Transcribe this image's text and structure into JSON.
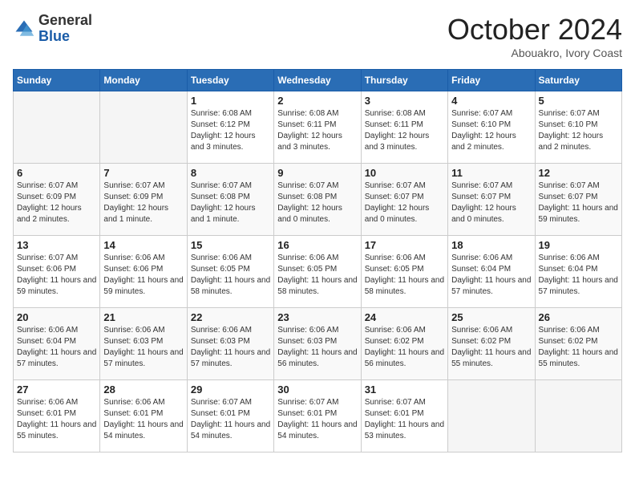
{
  "header": {
    "logo_general": "General",
    "logo_blue": "Blue",
    "month_title": "October 2024",
    "subtitle": "Abouakro, Ivory Coast"
  },
  "days_of_week": [
    "Sunday",
    "Monday",
    "Tuesday",
    "Wednesday",
    "Thursday",
    "Friday",
    "Saturday"
  ],
  "weeks": [
    [
      {
        "day": "",
        "info": ""
      },
      {
        "day": "",
        "info": ""
      },
      {
        "day": "1",
        "info": "Sunrise: 6:08 AM\nSunset: 6:12 PM\nDaylight: 12 hours and 3 minutes."
      },
      {
        "day": "2",
        "info": "Sunrise: 6:08 AM\nSunset: 6:11 PM\nDaylight: 12 hours and 3 minutes."
      },
      {
        "day": "3",
        "info": "Sunrise: 6:08 AM\nSunset: 6:11 PM\nDaylight: 12 hours and 3 minutes."
      },
      {
        "day": "4",
        "info": "Sunrise: 6:07 AM\nSunset: 6:10 PM\nDaylight: 12 hours and 2 minutes."
      },
      {
        "day": "5",
        "info": "Sunrise: 6:07 AM\nSunset: 6:10 PM\nDaylight: 12 hours and 2 minutes."
      }
    ],
    [
      {
        "day": "6",
        "info": "Sunrise: 6:07 AM\nSunset: 6:09 PM\nDaylight: 12 hours and 2 minutes."
      },
      {
        "day": "7",
        "info": "Sunrise: 6:07 AM\nSunset: 6:09 PM\nDaylight: 12 hours and 1 minute."
      },
      {
        "day": "8",
        "info": "Sunrise: 6:07 AM\nSunset: 6:08 PM\nDaylight: 12 hours and 1 minute."
      },
      {
        "day": "9",
        "info": "Sunrise: 6:07 AM\nSunset: 6:08 PM\nDaylight: 12 hours and 0 minutes."
      },
      {
        "day": "10",
        "info": "Sunrise: 6:07 AM\nSunset: 6:07 PM\nDaylight: 12 hours and 0 minutes."
      },
      {
        "day": "11",
        "info": "Sunrise: 6:07 AM\nSunset: 6:07 PM\nDaylight: 12 hours and 0 minutes."
      },
      {
        "day": "12",
        "info": "Sunrise: 6:07 AM\nSunset: 6:07 PM\nDaylight: 11 hours and 59 minutes."
      }
    ],
    [
      {
        "day": "13",
        "info": "Sunrise: 6:07 AM\nSunset: 6:06 PM\nDaylight: 11 hours and 59 minutes."
      },
      {
        "day": "14",
        "info": "Sunrise: 6:06 AM\nSunset: 6:06 PM\nDaylight: 11 hours and 59 minutes."
      },
      {
        "day": "15",
        "info": "Sunrise: 6:06 AM\nSunset: 6:05 PM\nDaylight: 11 hours and 58 minutes."
      },
      {
        "day": "16",
        "info": "Sunrise: 6:06 AM\nSunset: 6:05 PM\nDaylight: 11 hours and 58 minutes."
      },
      {
        "day": "17",
        "info": "Sunrise: 6:06 AM\nSunset: 6:05 PM\nDaylight: 11 hours and 58 minutes."
      },
      {
        "day": "18",
        "info": "Sunrise: 6:06 AM\nSunset: 6:04 PM\nDaylight: 11 hours and 57 minutes."
      },
      {
        "day": "19",
        "info": "Sunrise: 6:06 AM\nSunset: 6:04 PM\nDaylight: 11 hours and 57 minutes."
      }
    ],
    [
      {
        "day": "20",
        "info": "Sunrise: 6:06 AM\nSunset: 6:04 PM\nDaylight: 11 hours and 57 minutes."
      },
      {
        "day": "21",
        "info": "Sunrise: 6:06 AM\nSunset: 6:03 PM\nDaylight: 11 hours and 57 minutes."
      },
      {
        "day": "22",
        "info": "Sunrise: 6:06 AM\nSunset: 6:03 PM\nDaylight: 11 hours and 57 minutes."
      },
      {
        "day": "23",
        "info": "Sunrise: 6:06 AM\nSunset: 6:03 PM\nDaylight: 11 hours and 56 minutes."
      },
      {
        "day": "24",
        "info": "Sunrise: 6:06 AM\nSunset: 6:02 PM\nDaylight: 11 hours and 56 minutes."
      },
      {
        "day": "25",
        "info": "Sunrise: 6:06 AM\nSunset: 6:02 PM\nDaylight: 11 hours and 55 minutes."
      },
      {
        "day": "26",
        "info": "Sunrise: 6:06 AM\nSunset: 6:02 PM\nDaylight: 11 hours and 55 minutes."
      }
    ],
    [
      {
        "day": "27",
        "info": "Sunrise: 6:06 AM\nSunset: 6:01 PM\nDaylight: 11 hours and 55 minutes."
      },
      {
        "day": "28",
        "info": "Sunrise: 6:06 AM\nSunset: 6:01 PM\nDaylight: 11 hours and 54 minutes."
      },
      {
        "day": "29",
        "info": "Sunrise: 6:07 AM\nSunset: 6:01 PM\nDaylight: 11 hours and 54 minutes."
      },
      {
        "day": "30",
        "info": "Sunrise: 6:07 AM\nSunset: 6:01 PM\nDaylight: 11 hours and 54 minutes."
      },
      {
        "day": "31",
        "info": "Sunrise: 6:07 AM\nSunset: 6:01 PM\nDaylight: 11 hours and 53 minutes."
      },
      {
        "day": "",
        "info": ""
      },
      {
        "day": "",
        "info": ""
      }
    ]
  ]
}
